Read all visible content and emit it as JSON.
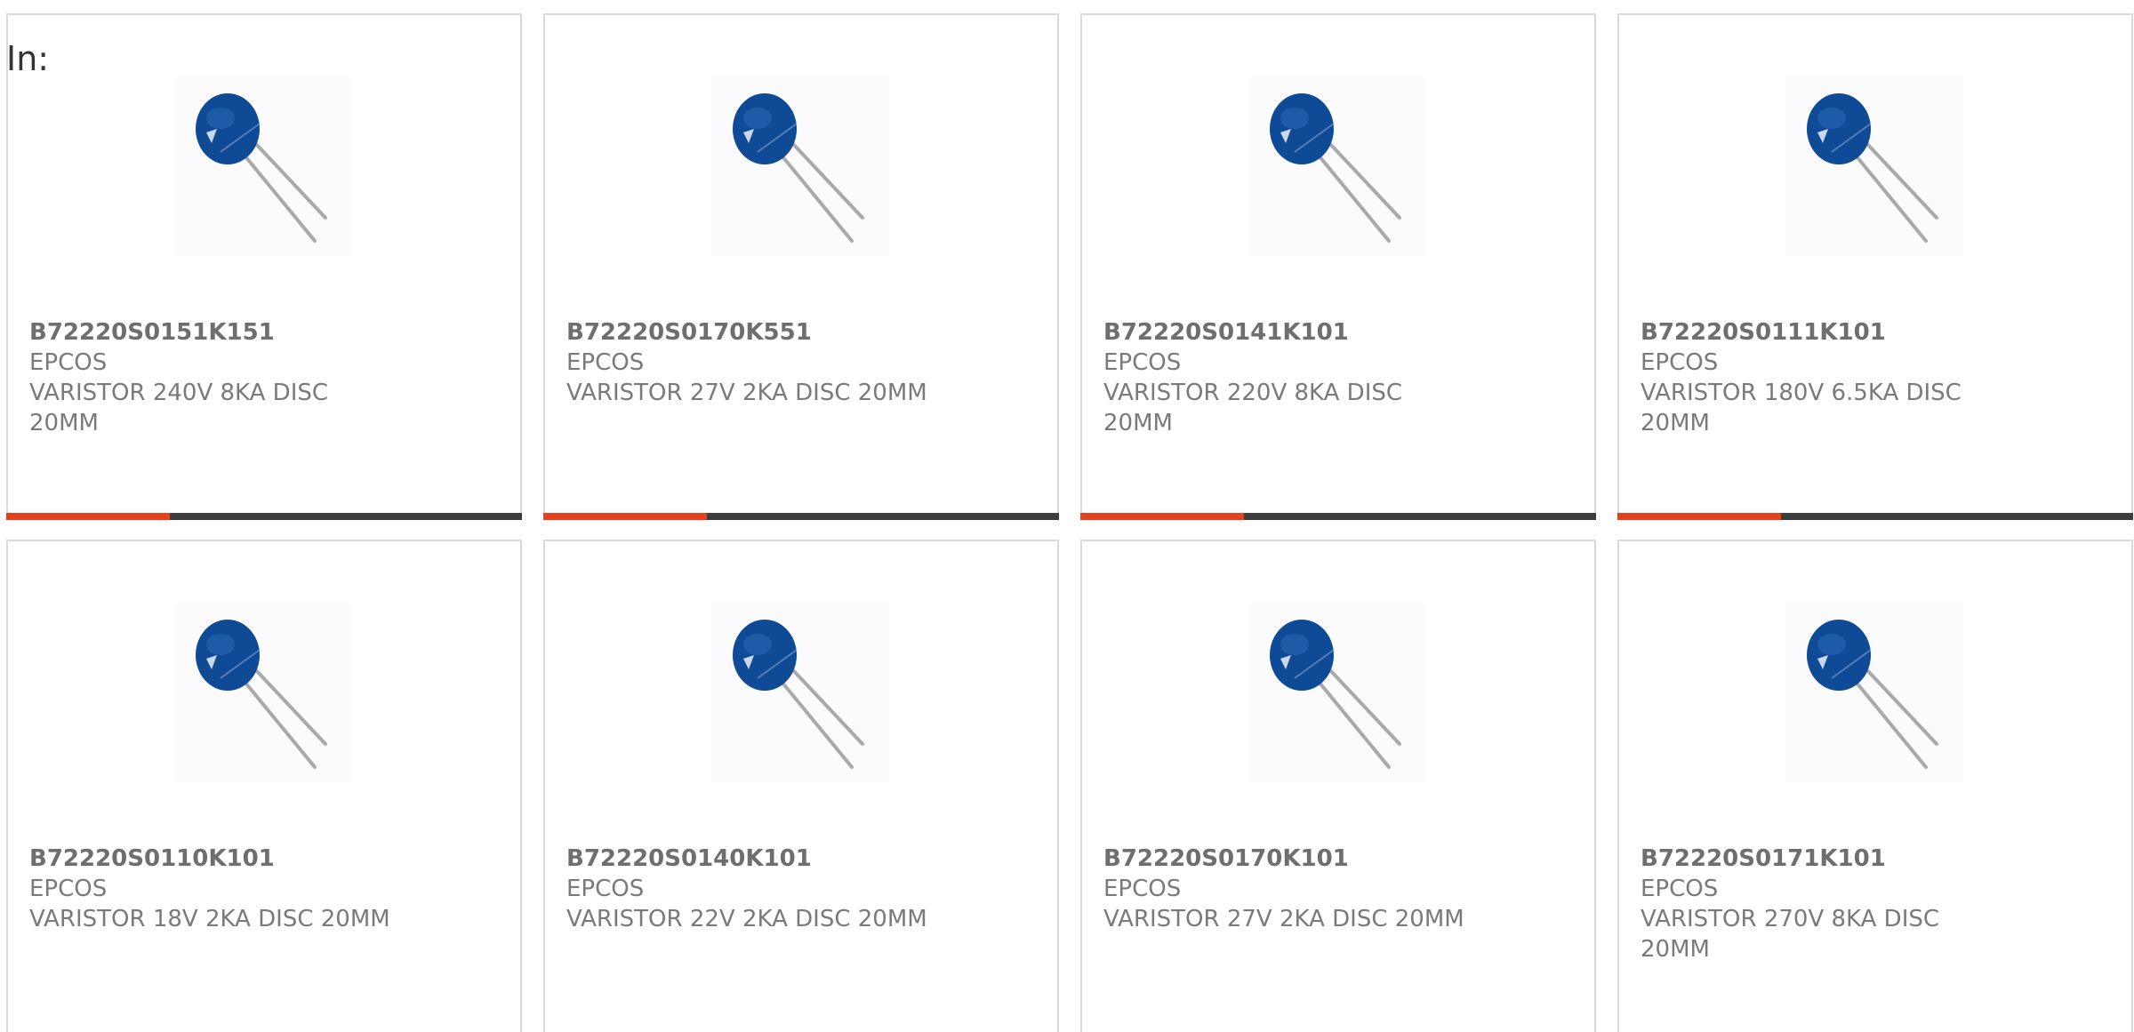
{
  "header": {
    "in_label": "In:"
  },
  "colors": {
    "accent": "#e8401c",
    "bar": "#3d3d3d",
    "varistor_body": "#0f4a96"
  },
  "products": [
    {
      "part": "B72220S0151K151",
      "manufacturer": "EPCOS",
      "description": "VARISTOR 240V 8KA DISC 20MM",
      "image_icon": "disc-varistor-icon"
    },
    {
      "part": "B72220S0170K551",
      "manufacturer": "EPCOS",
      "description": "VARISTOR 27V 2KA DISC 20MM",
      "image_icon": "disc-varistor-icon"
    },
    {
      "part": "B72220S0141K101",
      "manufacturer": "EPCOS",
      "description": "VARISTOR 220V 8KA DISC 20MM",
      "image_icon": "disc-varistor-icon"
    },
    {
      "part": "B72220S0111K101",
      "manufacturer": "EPCOS",
      "description": "VARISTOR 180V 6.5KA DISC 20MM",
      "image_icon": "disc-varistor-icon"
    },
    {
      "part": "B72220S0110K101",
      "manufacturer": "EPCOS",
      "description": "VARISTOR 18V 2KA DISC 20MM",
      "image_icon": "disc-varistor-icon"
    },
    {
      "part": "B72220S0140K101",
      "manufacturer": "EPCOS",
      "description": "VARISTOR 22V 2KA DISC 20MM",
      "image_icon": "disc-varistor-icon"
    },
    {
      "part": "B72220S0170K101",
      "manufacturer": "EPCOS",
      "description": "VARISTOR 27V 2KA DISC 20MM",
      "image_icon": "disc-varistor-icon"
    },
    {
      "part": "B72220S0171K101",
      "manufacturer": "EPCOS",
      "description": "VARISTOR 270V 8KA DISC 20MM",
      "image_icon": "disc-varistor-icon"
    }
  ]
}
